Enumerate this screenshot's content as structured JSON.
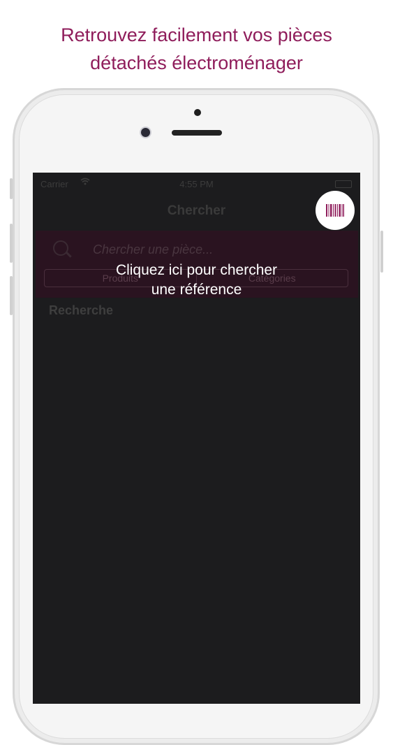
{
  "headline": {
    "line1": "Retrouvez facilement vos pièces",
    "line2": "détachés électroménager"
  },
  "status_bar": {
    "carrier": "Carrier",
    "time": "4:55 PM"
  },
  "navbar": {
    "title": "Chercher"
  },
  "search": {
    "placeholder": "Chercher une pièce..."
  },
  "segments": [
    "Produits",
    "Catégories"
  ],
  "section": {
    "label": "Recherche"
  },
  "tooltip": {
    "line1": "Cliquez ici pour chercher",
    "line2": "une référence"
  },
  "colors": {
    "brand": "#8f1d5b",
    "screen_bg": "#1c1c1e"
  },
  "icons": {
    "barcode": "barcode-icon",
    "search": "search-icon",
    "wifi": "wifi-icon",
    "battery": "battery-icon"
  }
}
